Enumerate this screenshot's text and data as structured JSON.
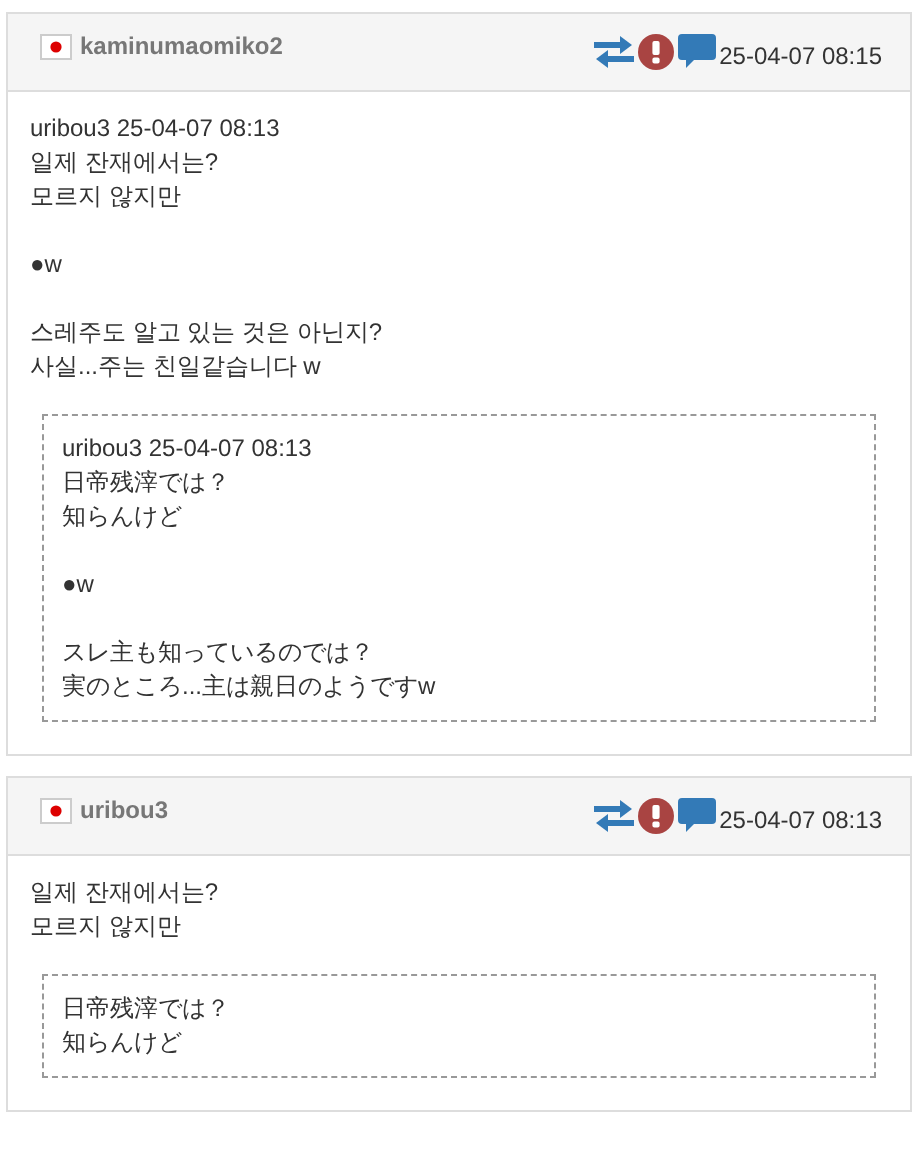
{
  "posts": [
    {
      "author": "kaminumaomiko2",
      "time": "25-04-07 08:15",
      "body": [
        [
          "uribou3 25-04-07 08:13",
          "일제 잔재에서는?",
          "모르지 않지만"
        ],
        [
          "●w"
        ],
        [
          "스레주도 알고 있는 것은 아닌지?",
          "사실...주는 친일같습니다 w"
        ]
      ],
      "quote": [
        [
          "uribou3 25-04-07 08:13",
          "日帝残滓では？",
          "知らんけど"
        ],
        [
          "●w"
        ],
        [
          "スレ主も知っているのでは？",
          "実のところ...主は親日のようですw"
        ]
      ]
    },
    {
      "author": "uribou3",
      "time": "25-04-07 08:13",
      "body": [
        [
          "일제 잔재에서는?",
          "모르지 않지만"
        ]
      ],
      "quote": [
        [
          "日帝残滓では？",
          "知らんけど"
        ]
      ]
    }
  ]
}
